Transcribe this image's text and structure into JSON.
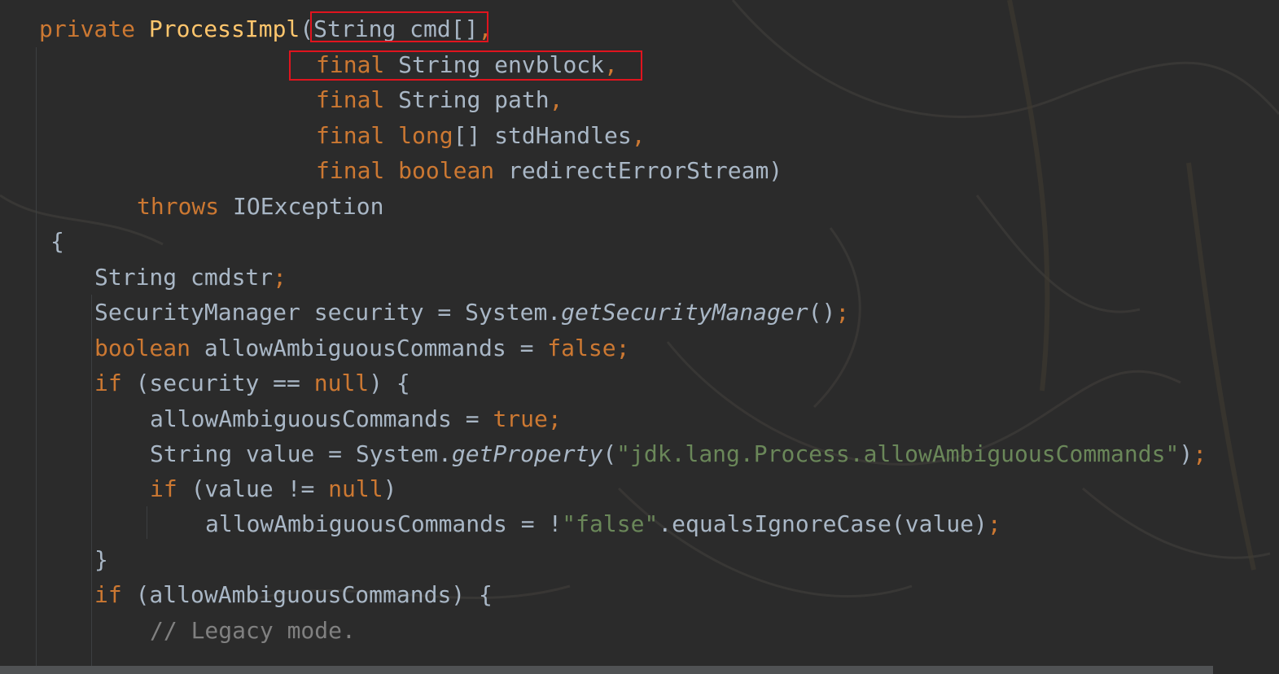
{
  "editor": {
    "lines": [
      {
        "tokens": [
          {
            "t": "private ",
            "c": "kw"
          },
          {
            "t": "ProcessImpl",
            "c": "fn"
          },
          {
            "t": "(String cmd[]",
            "c": "pl"
          },
          {
            "t": ",",
            "c": "kw"
          }
        ]
      },
      {
        "tokens": [
          {
            "t": "final ",
            "c": "kw"
          },
          {
            "t": "String envblock",
            "c": "pl"
          },
          {
            "t": ",",
            "c": "kw"
          }
        ]
      },
      {
        "tokens": [
          {
            "t": "final ",
            "c": "kw"
          },
          {
            "t": "String path",
            "c": "pl"
          },
          {
            "t": ",",
            "c": "kw"
          }
        ]
      },
      {
        "tokens": [
          {
            "t": "final ",
            "c": "kw"
          },
          {
            "t": "long",
            "c": "kw"
          },
          {
            "t": "[] stdHandles",
            "c": "pl"
          },
          {
            "t": ",",
            "c": "kw"
          }
        ]
      },
      {
        "tokens": [
          {
            "t": "final ",
            "c": "kw"
          },
          {
            "t": "boolean ",
            "c": "kw"
          },
          {
            "t": "redirectErrorStream)",
            "c": "pl"
          }
        ]
      },
      {
        "tokens": [
          {
            "t": "throws ",
            "c": "kw"
          },
          {
            "t": "IOException",
            "c": "pl"
          }
        ]
      },
      {
        "tokens": [
          {
            "t": "{",
            "c": "pl"
          }
        ]
      },
      {
        "tokens": [
          {
            "t": "String cmdstr",
            "c": "pl"
          },
          {
            "t": ";",
            "c": "kw"
          }
        ]
      },
      {
        "tokens": [
          {
            "t": "SecurityManager security = System.",
            "c": "pl"
          },
          {
            "t": "getSecurityManager",
            "c": "it"
          },
          {
            "t": "()",
            "c": "pl"
          },
          {
            "t": ";",
            "c": "kw"
          }
        ]
      },
      {
        "tokens": [
          {
            "t": "boolean ",
            "c": "kw"
          },
          {
            "t": "allowAmbiguousCommands = ",
            "c": "pl"
          },
          {
            "t": "false;",
            "c": "kw"
          }
        ]
      },
      {
        "tokens": [
          {
            "t": "if ",
            "c": "kw"
          },
          {
            "t": "(security == ",
            "c": "pl"
          },
          {
            "t": "null",
            "c": "kw"
          },
          {
            "t": ") {",
            "c": "pl"
          }
        ]
      },
      {
        "tokens": [
          {
            "t": "allowAmbiguousCommands = ",
            "c": "pl"
          },
          {
            "t": "true;",
            "c": "kw"
          }
        ]
      },
      {
        "tokens": [
          {
            "t": "String value = System.",
            "c": "pl"
          },
          {
            "t": "getProperty",
            "c": "it"
          },
          {
            "t": "(",
            "c": "pl"
          },
          {
            "t": "\"jdk.lang.Process.allowAmbiguousCommands\"",
            "c": "str"
          },
          {
            "t": ")",
            "c": "pl"
          },
          {
            "t": ";",
            "c": "kw"
          }
        ]
      },
      {
        "tokens": [
          {
            "t": "if ",
            "c": "kw"
          },
          {
            "t": "(value != ",
            "c": "pl"
          },
          {
            "t": "null",
            "c": "kw"
          },
          {
            "t": ")",
            "c": "pl"
          }
        ]
      },
      {
        "tokens": [
          {
            "t": "allowAmbiguousCommands = !",
            "c": "pl"
          },
          {
            "t": "\"false\"",
            "c": "str"
          },
          {
            "t": ".equalsIgnoreCase(value)",
            "c": "pl"
          },
          {
            "t": ";",
            "c": "kw"
          }
        ]
      },
      {
        "tokens": [
          {
            "t": "}",
            "c": "pl"
          }
        ]
      },
      {
        "tokens": [
          {
            "t": "if ",
            "c": "kw"
          },
          {
            "t": "(allowAmbiguousCommands) {",
            "c": "pl"
          }
        ]
      },
      {
        "tokens": [
          {
            "t": "// Legacy mode.",
            "c": "cm"
          }
        ]
      }
    ]
  },
  "colors": {
    "background": "#2b2b2b",
    "keyword": "#cc7832",
    "method": "#ffc66d",
    "string": "#6a8759",
    "comment": "#808080",
    "plain": "#a9b7c6",
    "highlight_box": "#e0141e"
  }
}
